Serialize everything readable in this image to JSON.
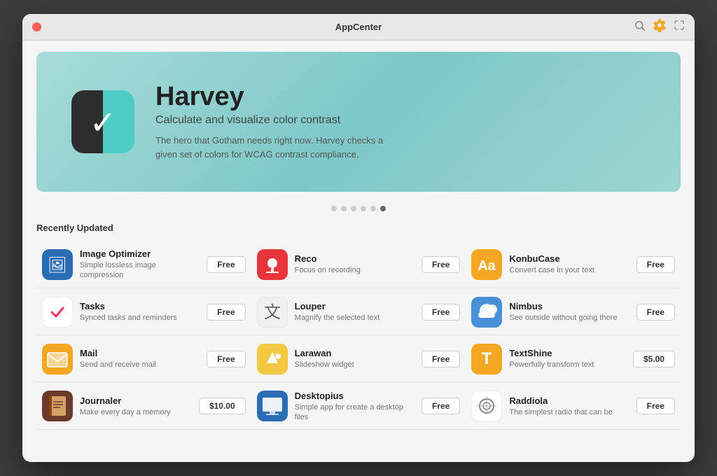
{
  "window": {
    "title": "AppCenter",
    "close_label": "×"
  },
  "titlebar": {
    "title": "AppCenter",
    "search_icon": "🔍",
    "gear_icon": "⚙",
    "expand_icon": "⛶"
  },
  "hero": {
    "app_name": "Harvey",
    "subtitle": "Calculate and visualize color contrast",
    "description": "The hero that Gotham needs right now. Harvey checks a given set of colors for WCAG contrast compliance."
  },
  "dots": [
    {
      "active": false
    },
    {
      "active": false
    },
    {
      "active": false
    },
    {
      "active": false
    },
    {
      "active": false
    },
    {
      "active": true
    }
  ],
  "section_title": "Recently Updated",
  "apps": [
    {
      "name": "Image Optimizer",
      "desc": "Simple lossless image compression",
      "price": "Free",
      "icon_type": "image-optimizer"
    },
    {
      "name": "Reco",
      "desc": "Focus on recording",
      "price": "Free",
      "icon_type": "reco"
    },
    {
      "name": "KonbuCase",
      "desc": "Convert case in your text",
      "price": "Free",
      "icon_type": "konbucase"
    },
    {
      "name": "Tasks",
      "desc": "Synced tasks and reminders",
      "price": "Free",
      "icon_type": "tasks"
    },
    {
      "name": "Louper",
      "desc": "Magnify the selected text",
      "price": "Free",
      "icon_type": "louper"
    },
    {
      "name": "Nimbus",
      "desc": "See outside without going there",
      "price": "Free",
      "icon_type": "nimbus"
    },
    {
      "name": "Mail",
      "desc": "Send and receive mail",
      "price": "Free",
      "icon_type": "mail"
    },
    {
      "name": "Larawan",
      "desc": "Slideshow widget",
      "price": "Free",
      "icon_type": "larawan"
    },
    {
      "name": "TextShine",
      "desc": "Powerfully transform text",
      "price": "$5.00",
      "icon_type": "textshine"
    },
    {
      "name": "Journaler",
      "desc": "Make every day a memory",
      "price": "$10.00",
      "icon_type": "journaler"
    },
    {
      "name": "Desktopius",
      "desc": "Simple app for create a desktop files",
      "price": "Free",
      "icon_type": "desktopius"
    },
    {
      "name": "Raddiola",
      "desc": "The simplest radio that can be",
      "price": "Free",
      "icon_type": "raddiola"
    }
  ]
}
